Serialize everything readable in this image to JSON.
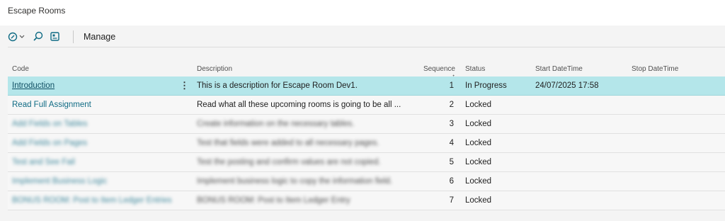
{
  "title": "Escape Rooms",
  "toolbar": {
    "manage_label": "Manage"
  },
  "columns": {
    "code": "Code",
    "description": "Description",
    "sequence": "Sequence",
    "sort_indicator": "↑",
    "status": "Status",
    "start": "Start DateTime",
    "stop": "Stop DateTime"
  },
  "rows": [
    {
      "code": "Introduction",
      "description": "This is a description for Escape Room Dev1.",
      "sequence": "1",
      "status": "In Progress",
      "start": "24/07/2025 17:58",
      "stop": ""
    },
    {
      "code": "Read Full Assignment",
      "description": "Read what all these upcoming rooms is going to be all ...",
      "sequence": "2",
      "status": "Locked",
      "start": "",
      "stop": ""
    },
    {
      "code": "Add Fields on Tables",
      "description": "Create information on the necessary tables.",
      "sequence": "3",
      "status": "Locked",
      "start": "",
      "stop": ""
    },
    {
      "code": "Add Fields on Pages",
      "description": "Test that fields were added to all necessary pages.",
      "sequence": "4",
      "status": "Locked",
      "start": "",
      "stop": ""
    },
    {
      "code": "Test and See Fail",
      "description": "Test the posting and confirm values are not copied.",
      "sequence": "5",
      "status": "Locked",
      "start": "",
      "stop": ""
    },
    {
      "code": "Implement Business Logic",
      "description": "Implement business logic to copy the information field.",
      "sequence": "6",
      "status": "Locked",
      "start": "",
      "stop": ""
    },
    {
      "code": "BONUS ROOM: Post to Item Ledger Entries",
      "description": "BONUS ROOM: Post to Item Ledger Entry",
      "sequence": "7",
      "status": "Locked",
      "start": "",
      "stop": ""
    }
  ]
}
